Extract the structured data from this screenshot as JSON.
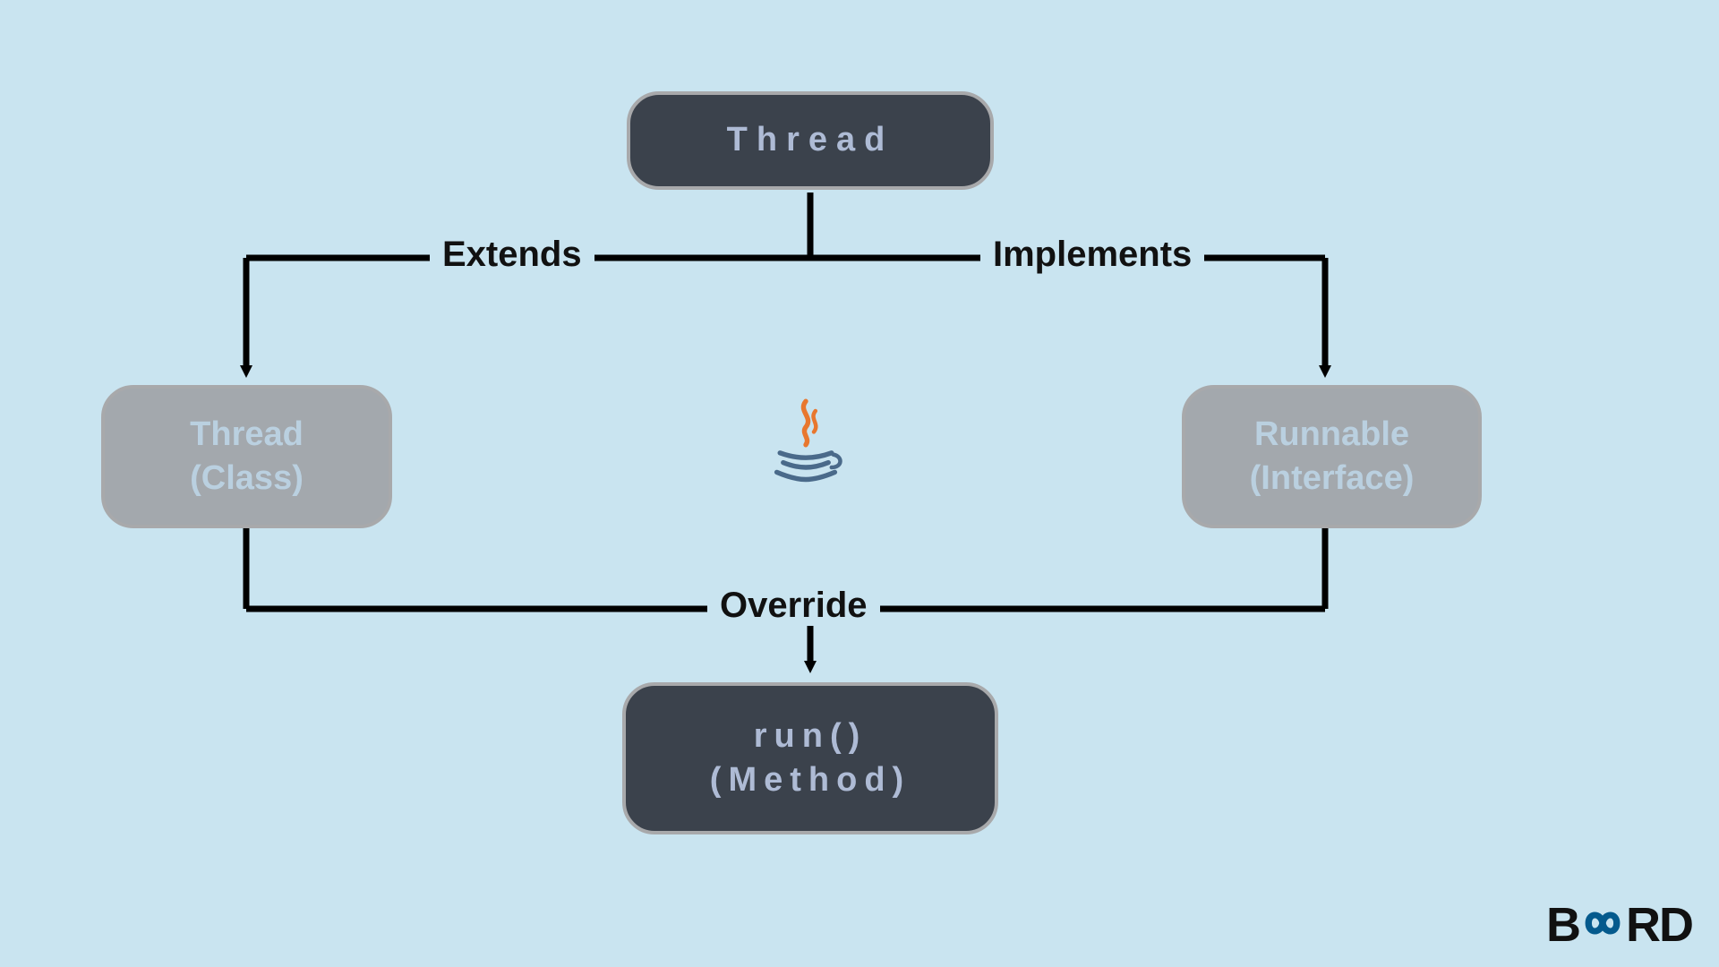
{
  "nodes": {
    "thread_top": {
      "label": "Thread"
    },
    "thread_class": {
      "line1": "Thread",
      "line2": "(Class)"
    },
    "runnable": {
      "line1": "Runnable",
      "line2": "(Interface)"
    },
    "run_method": {
      "line1": "run()",
      "line2": "(Method)"
    }
  },
  "edges": {
    "extends": "Extends",
    "implements": "Implements",
    "override": "Override"
  },
  "branding": {
    "prefix": "B",
    "mid": "∞",
    "suffix": "RD"
  },
  "icons": {
    "java": "java-icon"
  }
}
